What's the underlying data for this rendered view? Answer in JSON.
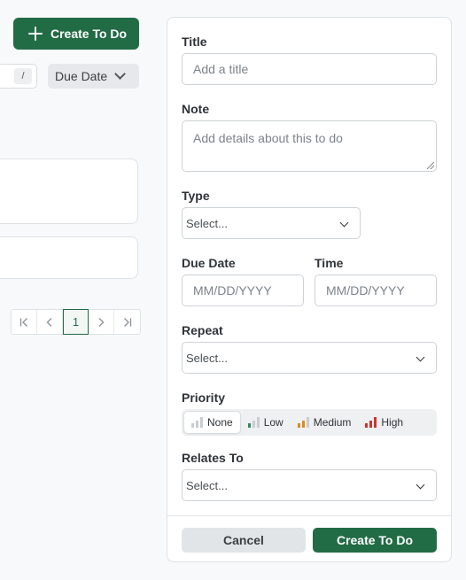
{
  "toolbar": {
    "create_label": "Create To Do",
    "search_shortcut": "/",
    "sort_label": "Due Date"
  },
  "pagination": {
    "first": "K",
    "prev": "<",
    "current": "1",
    "next": ">",
    "last": ">|"
  },
  "form": {
    "title_label": "Title",
    "title_placeholder": "Add a title",
    "note_label": "Note",
    "note_placeholder": "Add details about this to do",
    "type_label": "Type",
    "type_value": "Select...",
    "due_date_label": "Due Date",
    "due_date_placeholder": "MM/DD/YYYY",
    "time_label": "Time",
    "time_placeholder": "MM/DD/YYYY",
    "repeat_label": "Repeat",
    "repeat_value": "Select...",
    "priority_label": "Priority",
    "priority_options": [
      {
        "label": "None",
        "bar_colors": [
          "#c9cdd1",
          "#c9cdd1",
          "#c9cdd1"
        ]
      },
      {
        "label": "Low",
        "bar_colors": [
          "#2e8b57",
          "#c9cdd1",
          "#c9cdd1"
        ]
      },
      {
        "label": "Medium",
        "bar_colors": [
          "#e08a1e",
          "#e08a1e",
          "#c9cdd1"
        ]
      },
      {
        "label": "High",
        "bar_colors": [
          "#d0342c",
          "#d0342c",
          "#d0342c"
        ]
      }
    ],
    "priority_selected": "None",
    "relates_to_label": "Relates To",
    "relates_to_value": "Select...",
    "cancel_label": "Cancel",
    "submit_label": "Create To Do"
  },
  "colors": {
    "primary": "#216b45",
    "neutral_button": "#e2e5e8"
  }
}
